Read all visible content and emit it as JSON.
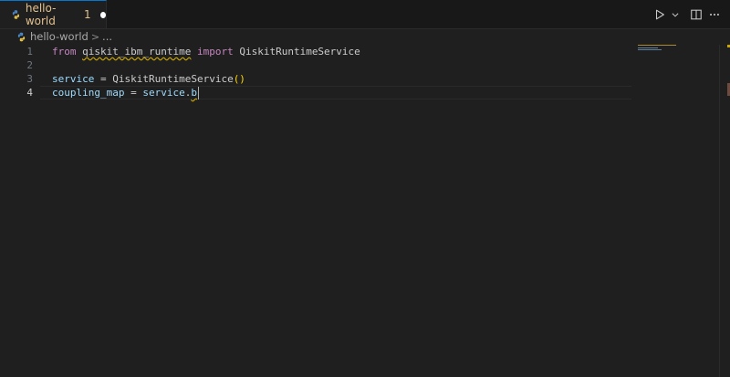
{
  "tab": {
    "label": "hello-world",
    "badge": "1",
    "icon": "python-file-icon",
    "dirty": true,
    "label_color": "#e2c08d"
  },
  "actions": {
    "run_icon": "play-icon",
    "run_menu_icon": "chevron-down-icon",
    "split_icon": "split-editor-icon",
    "more_icon": "ellipsis-icon"
  },
  "breadcrumb": {
    "file": "hello-world",
    "separator": ">",
    "more": "..."
  },
  "editor": {
    "active_line": 4,
    "lines": [
      {
        "number": "1"
      },
      {
        "number": "2"
      },
      {
        "number": "3"
      },
      {
        "number": "4"
      }
    ],
    "tokens": {
      "l1_from": "from",
      "l1_module": "qiskit_ibm_runtime",
      "l1_import": "import",
      "l1_name": "QiskitRuntimeService",
      "l3_var": "service",
      "l3_eq": " = ",
      "l3_cls": "QiskitRuntimeService",
      "l3_parens": "()",
      "l4_var": "coupling_map",
      "l4_eq": " = ",
      "l4_obj": "service",
      "l4_dot": ".",
      "l4_attr": "b"
    }
  },
  "colors": {
    "background": "#1f1f1f",
    "keyword": "#c586c0",
    "variable": "#9cdcfe",
    "warning": "#cca700",
    "bracket": "#ffd700"
  }
}
